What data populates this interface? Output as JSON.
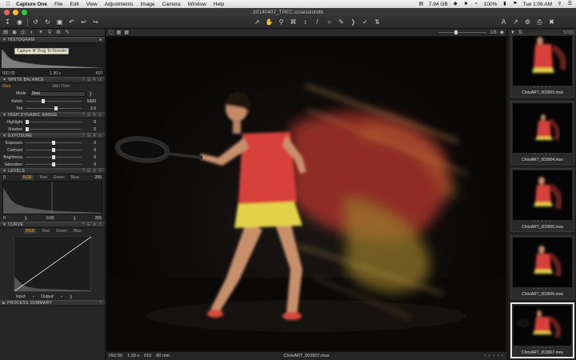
{
  "menubar": {
    "app_name": "Capture One",
    "menus": [
      "File",
      "Edit",
      "View",
      "Adjustments",
      "Image",
      "Camera",
      "Window",
      "Help"
    ],
    "battery_text": "7.94 GB",
    "battery_pct": "100%",
    "clock": "Tue 1:06 AM"
  },
  "window": {
    "title": "20140407_TPEC.cosessiondb"
  },
  "histogram": {
    "header": "HISTOGRAM",
    "tooltip": "Capture  ⌘  Drag To Reorder",
    "iso": "ISO 50",
    "shutter": "1.30 s",
    "aperture": "f/10"
  },
  "white_balance": {
    "header": "WHITE BALANCE",
    "tab_left": "Glex",
    "tab_skin": "Skin Tone",
    "mode_label": "Mode",
    "mode_value": "Shot",
    "kelvin_label": "Kelvin",
    "kelvin_value": "5320",
    "tint_label": "Tint",
    "tint_value": "2.6"
  },
  "hdr": {
    "header": "HIGH DYNAMIC RANGE",
    "highlight_label": "Highlight",
    "highlight_value": "0",
    "shadow_label": "Shadow",
    "shadow_value": "0"
  },
  "exposure": {
    "header": "EXPOSURE",
    "rows": [
      {
        "label": "Exposure",
        "value": "0"
      },
      {
        "label": "Contrast",
        "value": "0"
      },
      {
        "label": "Brightness",
        "value": "0"
      },
      {
        "label": "Saturation",
        "value": "0"
      }
    ]
  },
  "levels": {
    "header": "LEVELS",
    "left_val": "0",
    "right_val": "255",
    "channels": [
      "RGB",
      "Red",
      "Green",
      "Blue"
    ],
    "out_low": "0",
    "mid": "0.00",
    "out_high": "255"
  },
  "curve": {
    "header": "CURVE",
    "channels": [
      "RGB",
      "Red",
      "Green",
      "Blue"
    ],
    "input_label": "Input:",
    "input_value": "–",
    "output_label": "Output:",
    "output_value": "–"
  },
  "process_summary": {
    "header": "PROCESS SUMMARY"
  },
  "viewer": {
    "zoom_level": "1/8",
    "foot_iso": "ISO 50",
    "foot_shutter": "1.30 s",
    "foot_aperture": "f/10",
    "foot_focal": "80 mm",
    "filename": "ChrisART_003907.mos"
  },
  "browser": {
    "count": "5/233",
    "thumbs": [
      {
        "caption": "ChrisART_003903.mos"
      },
      {
        "caption": "ChrisART_003904.mos"
      },
      {
        "caption": "ChrisART_003905.mos"
      },
      {
        "caption": "ChrisART_003906.mos"
      },
      {
        "caption": "ChrisART_003907.mos"
      }
    ]
  },
  "colors": {
    "accent": "#f39c12",
    "panel": "#262626",
    "viewer_bg": "#0c0c0c",
    "dress": "#d8413a",
    "skirt": "#e3d24a"
  },
  "icons": [
    "apple-icon",
    "import-icon",
    "capture-icon",
    "rotate-icon",
    "undo-icon",
    "redo-icon",
    "crop-icon",
    "eyedropper-icon",
    "grid-icon",
    "settings-icon",
    "eye-icon"
  ]
}
